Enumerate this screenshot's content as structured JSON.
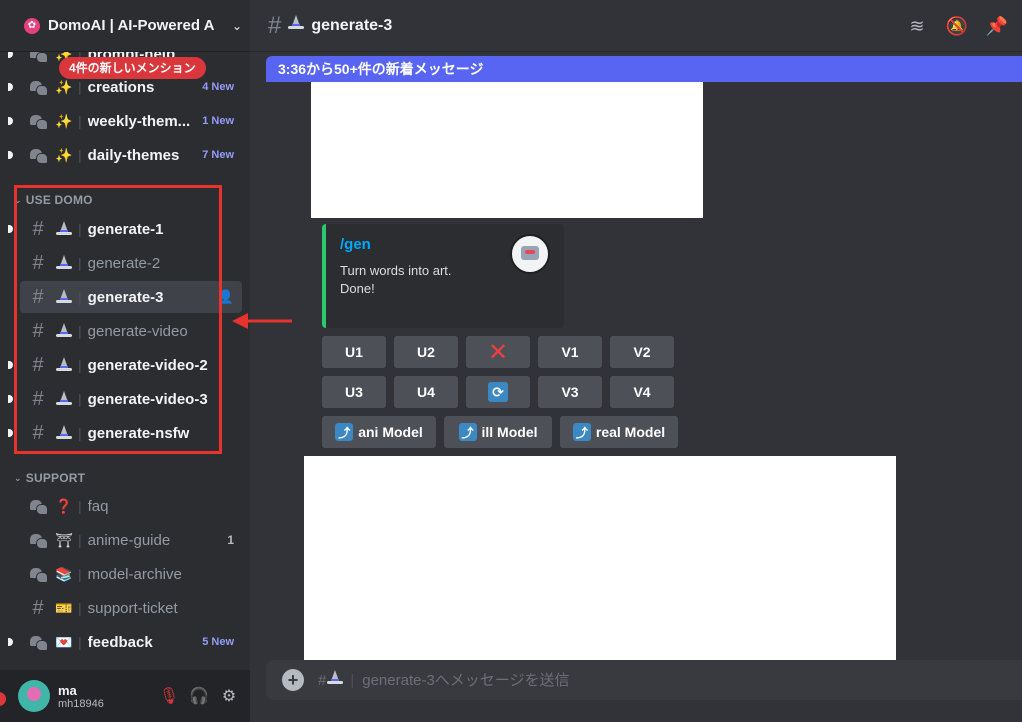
{
  "server": {
    "name": "DomoAI | AI-Powered A",
    "icon": "domoai-server-icon"
  },
  "mention_pill": "4件の新しいメンション",
  "channels_top": [
    {
      "name": "prompt-help",
      "emoji": "✨",
      "icon": "thread-icon",
      "badge": "",
      "unread": true,
      "bold": true
    },
    {
      "name": "creations",
      "emoji": "✨",
      "icon": "thread-icon",
      "badge": "4 New",
      "unread": true,
      "bold": true
    },
    {
      "name": "weekly-them...",
      "emoji": "✨",
      "icon": "thread-icon",
      "badge": "1 New",
      "unread": true,
      "bold": true
    },
    {
      "name": "daily-themes",
      "emoji": "✨",
      "icon": "thread-icon",
      "badge": "7 New",
      "unread": true,
      "bold": true
    }
  ],
  "category_use_domo": "USE DOMO",
  "channels_domo": [
    {
      "name": "generate-1",
      "bold": true,
      "unread": true
    },
    {
      "name": "generate-2",
      "bold": false,
      "unread": false
    },
    {
      "name": "generate-3",
      "bold": true,
      "unread": false,
      "active": true
    },
    {
      "name": "generate-video",
      "bold": false,
      "unread": false
    },
    {
      "name": "generate-video-2",
      "bold": true,
      "unread": true
    },
    {
      "name": "generate-video-3",
      "bold": true,
      "unread": true
    },
    {
      "name": "generate-nsfw",
      "bold": true,
      "unread": true
    }
  ],
  "category_support": "SUPPORT",
  "channels_support": [
    {
      "name": "faq",
      "emoji": "❓",
      "icon": "thread-icon",
      "badge": "",
      "bold": false
    },
    {
      "name": "anime-guide",
      "emoji": "⛩",
      "icon": "thread-icon",
      "badge": "1",
      "bold": false
    },
    {
      "name": "model-archive",
      "emoji": "📚",
      "icon": "thread-icon",
      "badge": "",
      "bold": false
    },
    {
      "name": "support-ticket",
      "emoji": "🎫",
      "icon": "hash-icon",
      "badge": "",
      "bold": false
    },
    {
      "name": "feedback",
      "emoji": "💌",
      "icon": "thread-icon",
      "badge": "5 New",
      "bold": true,
      "unread": true
    }
  ],
  "user": {
    "name": "ma",
    "tag": "mh18946"
  },
  "topbar": {
    "channel": "generate-3"
  },
  "new_messages_bar": "3:36から50+件の新着メッセージ",
  "embed": {
    "command": "/gen",
    "line1": "Turn words into art.",
    "line2": "Done!"
  },
  "buttons_row1": [
    "U1",
    "U2",
    "",
    "V1",
    "V2"
  ],
  "buttons_row2": [
    "U3",
    "U4",
    "",
    "V3",
    "V4"
  ],
  "buttons_row3": [
    "ani Model",
    "ill Model",
    "real Model"
  ],
  "composer": {
    "placeholder": "generate-3へメッセージを送信"
  },
  "colors": {
    "accent": "#5865f2",
    "highlight": "#e8322c",
    "mention": "#da373c",
    "embed_bar": "#2dc770"
  }
}
